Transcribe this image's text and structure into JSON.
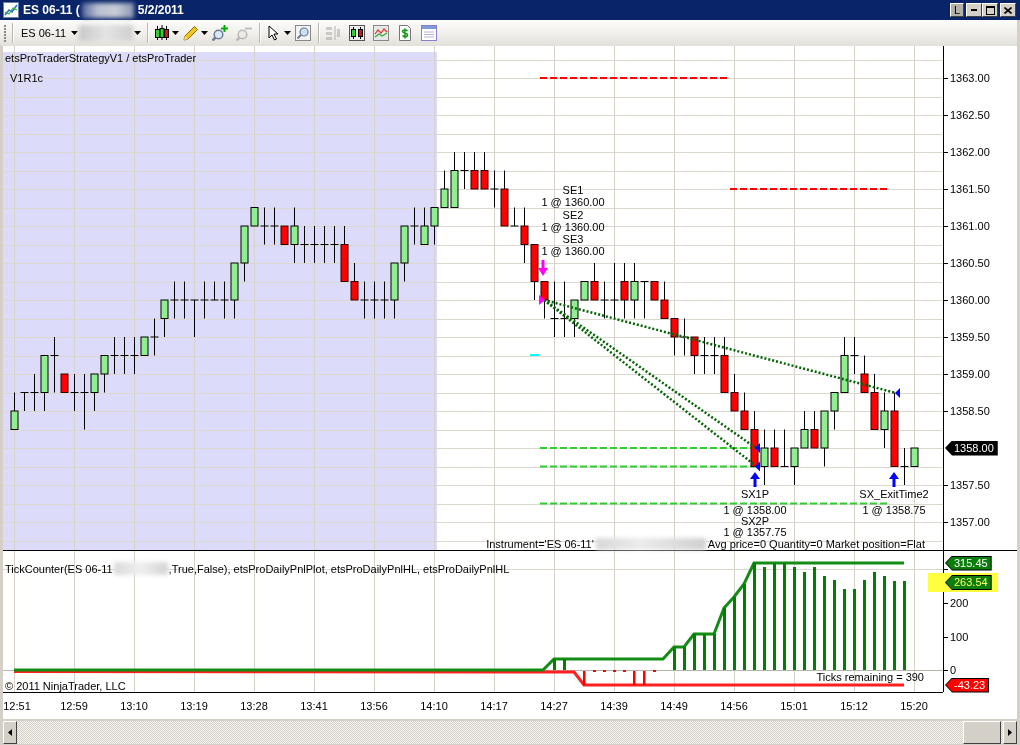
{
  "window": {
    "title_segments": [
      "ES 06-11 (",
      "5/2/2011"
    ],
    "layout_button": "L"
  },
  "toolbar": {
    "instrument": "ES 06-11",
    "tool_groups": [
      [
        {
          "kind": "candles",
          "dropdown": true,
          "disabled": false
        },
        {
          "kind": "pencil",
          "dropdown": true,
          "disabled": false
        },
        {
          "kind": "zoom_in",
          "dropdown": false,
          "disabled": false
        },
        {
          "kind": "zoom_out",
          "dropdown": false,
          "disabled": true
        }
      ],
      [
        {
          "kind": "pointer",
          "dropdown": true,
          "disabled": false
        },
        {
          "kind": "magnifier",
          "dropdown": false,
          "disabled": false
        }
      ],
      [
        {
          "kind": "split",
          "dropdown": false,
          "disabled": true
        },
        {
          "kind": "bar_chart",
          "dropdown": false,
          "disabled": false
        },
        {
          "kind": "line_chart",
          "dropdown": false,
          "disabled": false
        },
        {
          "kind": "dollar",
          "dropdown": false,
          "disabled": false
        },
        {
          "kind": "table",
          "dropdown": false,
          "disabled": false
        }
      ]
    ]
  },
  "price_panel": {
    "strategy_label": "etsProTraderStrategyV1 / etsProTrader",
    "version_label": "V1R1c",
    "price_ticks": [
      "1363.00",
      "1362.50",
      "1362.00",
      "1361.50",
      "1361.00",
      "1360.50",
      "1360.00",
      "1359.50",
      "1359.00",
      "1358.50",
      "1357.50",
      "1357.00"
    ],
    "last_price": "1358.00",
    "entries": [
      {
        "name": "SE1",
        "fill": "1 @ 1360.00"
      },
      {
        "name": "SE2",
        "fill": "1 @ 1360.00"
      },
      {
        "name": "SE3",
        "fill": "1 @ 1360.00"
      }
    ],
    "exits": [
      {
        "name": "SX1P",
        "fill": "1 @ 1358.00"
      },
      {
        "name": "SX2P",
        "fill": "1 @ 1357.75"
      },
      {
        "name": "SX_ExitTime2",
        "fill": "1 @ 1358.75"
      }
    ],
    "status": {
      "instrument": "Instrument='ES 06-11'",
      "position": "Avg price=0 Quantity=0 Market position=Flat"
    }
  },
  "indicator_panel": {
    "label_start": "TickCounter(ES 06-11",
    "label_end": ",True,False), etsProDailyPnlPlot, etsProDailyPnlHL, etsProDailyPnlHL",
    "ticks": [
      "200",
      "100",
      "0"
    ],
    "tags": [
      {
        "kind": "high",
        "text": "315.45",
        "highlighted": false
      },
      {
        "kind": "current",
        "text": "263.54",
        "highlighted": true
      },
      {
        "kind": "low",
        "text": "-43.23",
        "highlighted": false
      }
    ],
    "ticks_remaining": "Ticks remaining = 390",
    "copyright": "© 2011 NinjaTrader, LLC"
  },
  "time_axis": {
    "labels": [
      "12:51",
      "12:59",
      "13:10",
      "13:19",
      "13:28",
      "13:41",
      "13:56",
      "14:10",
      "14:17",
      "14:27",
      "14:39",
      "14:49",
      "14:56",
      "15:01",
      "15:12",
      "15:20"
    ]
  }
}
